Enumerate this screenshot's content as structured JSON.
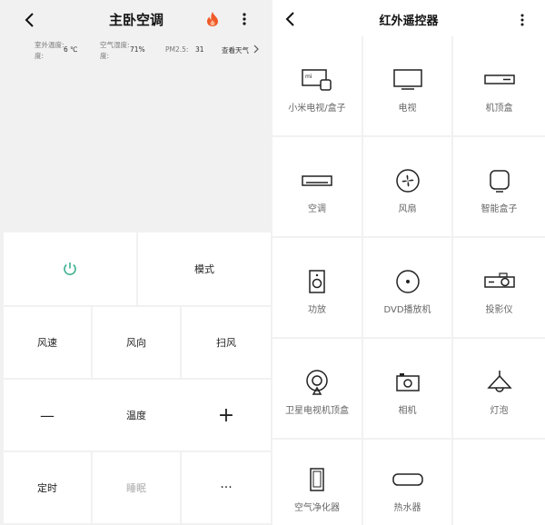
{
  "left": {
    "title": "主卧空调",
    "info": {
      "outdoor_temp_label": "室外温度:",
      "outdoor_temp_label_line2": "度:",
      "outdoor_temp_value": "6 ℃",
      "air_humidity_label": "空气湿度:",
      "air_humidity_label_line2": "度:",
      "air_humidity_value": "71%",
      "pm25_label": "PM2.5:",
      "pm25_value": "31",
      "weather_link": "查看天气"
    },
    "controls": {
      "mode": "模式",
      "wind_speed": "风速",
      "wind_direction": "风向",
      "swing": "扫风",
      "minus": "—",
      "temperature": "温度",
      "plus": "+",
      "timer": "定时",
      "sleep": "睡眠",
      "more": "···"
    },
    "colors": {
      "power": "#3bb08f",
      "fire": "#f05a28"
    }
  },
  "right": {
    "title": "红外遥控器",
    "devices": [
      {
        "label": "小米电视/盒子",
        "icon": "mi-tv-box-icon"
      },
      {
        "label": "电视",
        "icon": "tv-icon"
      },
      {
        "label": "机顶盒",
        "icon": "set-top-box-icon"
      },
      {
        "label": "空调",
        "icon": "air-conditioner-icon"
      },
      {
        "label": "风扇",
        "icon": "fan-icon"
      },
      {
        "label": "智能盒子",
        "icon": "smart-box-icon"
      },
      {
        "label": "功放",
        "icon": "amplifier-icon"
      },
      {
        "label": "DVD播放机",
        "icon": "dvd-icon"
      },
      {
        "label": "投影仪",
        "icon": "projector-icon"
      },
      {
        "label": "卫星电视机顶盒",
        "icon": "satellite-icon"
      },
      {
        "label": "相机",
        "icon": "camera-icon"
      },
      {
        "label": "灯泡",
        "icon": "lamp-icon"
      },
      {
        "label": "空气净化器",
        "icon": "air-purifier-icon"
      },
      {
        "label": "热水器",
        "icon": "water-heater-icon"
      }
    ]
  }
}
